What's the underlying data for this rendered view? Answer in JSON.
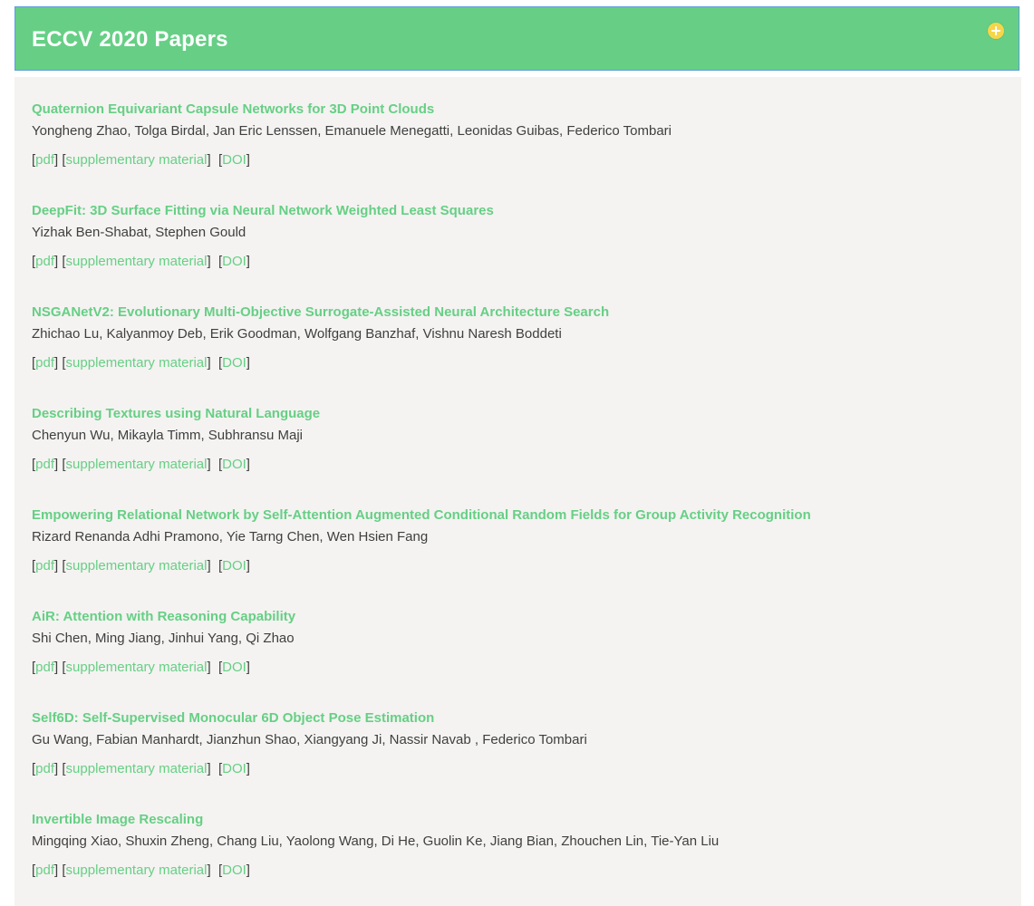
{
  "header": {
    "title": "ECCV 2020 Papers",
    "expand_icon": "plus-circle-icon",
    "background": "#66cf85",
    "icon_color": "#f5d64a"
  },
  "papers": [
    {
      "title": "Quaternion Equivariant Capsule Networks for 3D Point Clouds",
      "authors": "Yongheng Zhao, Tolga Birdal, Jan Eric Lenssen, Emanuele Menegatti, Leonidas Guibas, Federico Tombari",
      "links": {
        "pdf": "pdf",
        "supplementary": "supplementary material",
        "doi": "DOI"
      }
    },
    {
      "title": "DeepFit: 3D Surface Fitting via Neural Network Weighted Least Squares",
      "authors": "Yizhak Ben-Shabat, Stephen Gould",
      "links": {
        "pdf": "pdf",
        "supplementary": "supplementary material",
        "doi": "DOI"
      }
    },
    {
      "title": "NSGANetV2: Evolutionary Multi-Objective Surrogate-Assisted Neural Architecture Search",
      "authors": "Zhichao Lu, Kalyanmoy Deb, Erik Goodman, Wolfgang Banzhaf, Vishnu Naresh Boddeti",
      "links": {
        "pdf": "pdf",
        "supplementary": "supplementary material",
        "doi": "DOI"
      }
    },
    {
      "title": "Describing Textures using Natural Language",
      "authors": "Chenyun Wu, Mikayla Timm, Subhransu Maji",
      "links": {
        "pdf": "pdf",
        "supplementary": "supplementary material",
        "doi": "DOI"
      }
    },
    {
      "title": "Empowering Relational Network by Self-Attention Augmented Conditional Random Fields for Group Activity Recognition",
      "authors": "Rizard Renanda Adhi Pramono, Yie Tarng Chen, Wen Hsien Fang",
      "links": {
        "pdf": "pdf",
        "supplementary": "supplementary material",
        "doi": "DOI"
      }
    },
    {
      "title": "AiR: Attention with Reasoning Capability",
      "authors": "Shi Chen, Ming Jiang, Jinhui Yang, Qi Zhao",
      "links": {
        "pdf": "pdf",
        "supplementary": "supplementary material",
        "doi": "DOI"
      }
    },
    {
      "title": "Self6D: Self-Supervised Monocular 6D Object Pose Estimation",
      "authors": "Gu Wang, Fabian Manhardt, Jianzhun Shao, Xiangyang Ji, Nassir Navab , Federico Tombari",
      "links": {
        "pdf": "pdf",
        "supplementary": "supplementary material",
        "doi": "DOI"
      }
    },
    {
      "title": "Invertible Image Rescaling",
      "authors": "Mingqing Xiao, Shuxin Zheng, Chang Liu, Yaolong Wang, Di He, Guolin Ke, Jiang Bian, Zhouchen Lin, Tie-Yan Liu",
      "links": {
        "pdf": "pdf",
        "supplementary": "supplementary material",
        "doi": "DOI"
      }
    }
  ]
}
